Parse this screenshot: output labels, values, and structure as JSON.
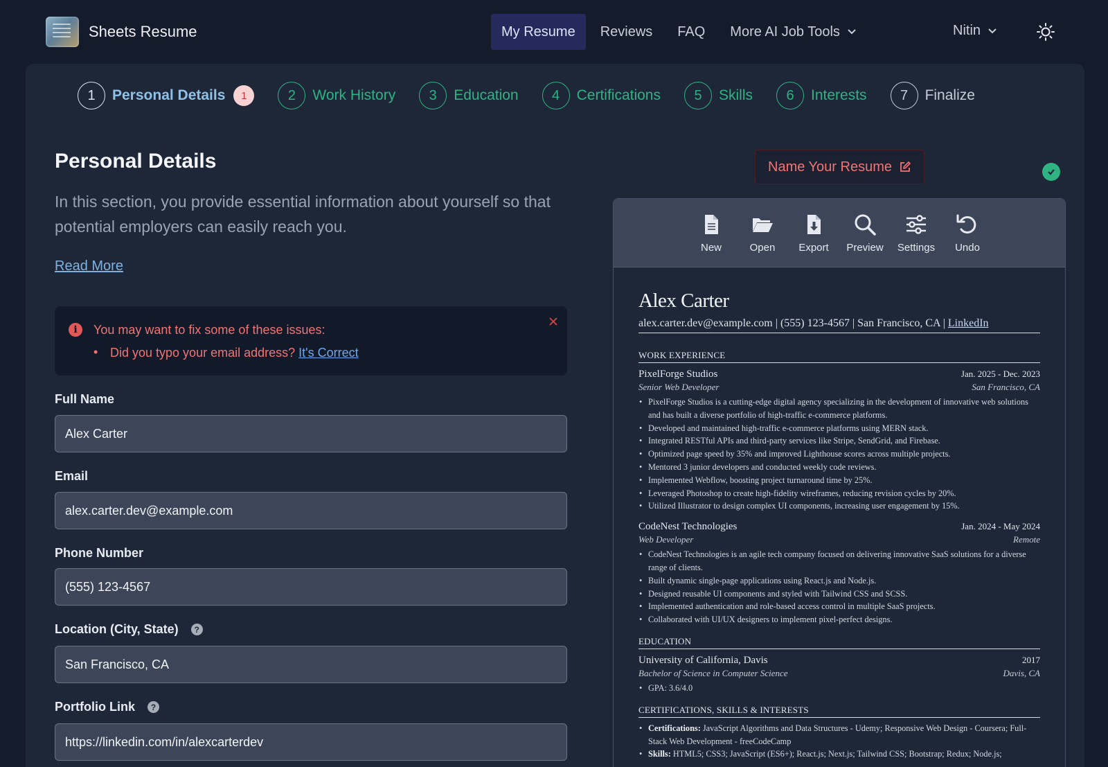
{
  "brand": {
    "name": "Sheets Resume"
  },
  "nav": {
    "links": [
      "My Resume",
      "Reviews",
      "FAQ",
      "More AI Job Tools"
    ],
    "user": "Nitin",
    "active_color": "#252a5c"
  },
  "steps": [
    {
      "num": "1",
      "label": "Personal Details",
      "badge": "1"
    },
    {
      "num": "2",
      "label": "Work History"
    },
    {
      "num": "3",
      "label": "Education"
    },
    {
      "num": "4",
      "label": "Certifications"
    },
    {
      "num": "5",
      "label": "Skills"
    },
    {
      "num": "6",
      "label": "Interests"
    },
    {
      "num": "7",
      "label": "Finalize"
    }
  ],
  "section": {
    "title": "Personal Details",
    "intro": "In this section, you provide essential information about yourself so that potential employers can easily reach you.",
    "read_more": "Read More"
  },
  "issues": {
    "title": "You may want to fix some of these issues:",
    "item": "Did you typo your email address?",
    "link": "It's Correct"
  },
  "form": {
    "full_name": {
      "label": "Full Name",
      "value": "Alex Carter"
    },
    "email": {
      "label": "Email",
      "value": "alex.carter.dev@example.com"
    },
    "phone": {
      "label": "Phone Number",
      "value": "(555) 123-4567"
    },
    "location": {
      "label": "Location (City, State)",
      "value": "San Francisco, CA"
    },
    "portfolio": {
      "label": "Portfolio Link",
      "value": "https://linkedin.com/in/alexcarterdev"
    }
  },
  "name_resume": "Name Your Resume",
  "toolbar": [
    "New",
    "Open",
    "Export",
    "Preview",
    "Settings",
    "Undo"
  ],
  "resume": {
    "name": "Alex Carter",
    "contact": "alex.carter.dev@example.com | (555) 123-4567 | San Francisco, CA | ",
    "contact_link": "LinkedIn",
    "work_heading": "WORK EXPERIENCE",
    "jobs": [
      {
        "company": "PixelForge Studios",
        "dates": "Jan. 2025 - Dec. 2023",
        "role": "Senior Web Developer",
        "location": "San Francisco, CA",
        "bullets": [
          "PixelForge Studios is a cutting-edge digital agency specializing in the development of innovative web solutions and has built a diverse portfolio of high-traffic e-commerce platforms.",
          "Developed and maintained high-traffic e-commerce platforms using MERN stack.",
          "Integrated RESTful APIs and third-party services like Stripe, SendGrid, and Firebase.",
          "Optimized page speed by 35% and improved Lighthouse scores across multiple projects.",
          "Mentored 3 junior developers and conducted weekly code reviews.",
          "Implemented Webflow, boosting project turnaround time by 25%.",
          "Leveraged Photoshop to create high-fidelity wireframes, reducing revision cycles by 20%.",
          "Utilized Illustrator to design complex UI components, increasing user engagement by 15%."
        ]
      },
      {
        "company": "CodeNest Technologies",
        "dates": "Jan. 2024 - May 2024",
        "role": "Web Developer",
        "location": "Remote",
        "bullets": [
          "CodeNest Technologies is an agile tech company focused on delivering innovative SaaS solutions for a diverse range of clients.",
          "Built dynamic single-page applications using React.js and Node.js.",
          "Designed reusable UI components and styled with Tailwind CSS and SCSS.",
          "Implemented authentication and role-based access control in multiple SaaS projects.",
          "Collaborated with UI/UX designers to implement pixel-perfect designs."
        ]
      }
    ],
    "edu_heading": "EDUCATION",
    "edu": {
      "school": "University of California, Davis",
      "year": "2017",
      "degree": "Bachelor of Science in Computer Science",
      "location": "Davis, CA",
      "gpa": "GPA: 3.6/4.0"
    },
    "cert_heading": "CERTIFICATIONS, SKILLS & INTERESTS",
    "certs_label": "Certifications:",
    "certs": "JavaScript Algorithms and Data Structures - Udemy; Responsive Web Design - Coursera; Full-Stack Web Development - freeCodeCamp",
    "skills_label": "Skills:",
    "skills": "HTML5; CSS3; JavaScript (ES6+); React.js; Next.js; Tailwind CSS; Bootstrap; Redux; Node.js;"
  }
}
